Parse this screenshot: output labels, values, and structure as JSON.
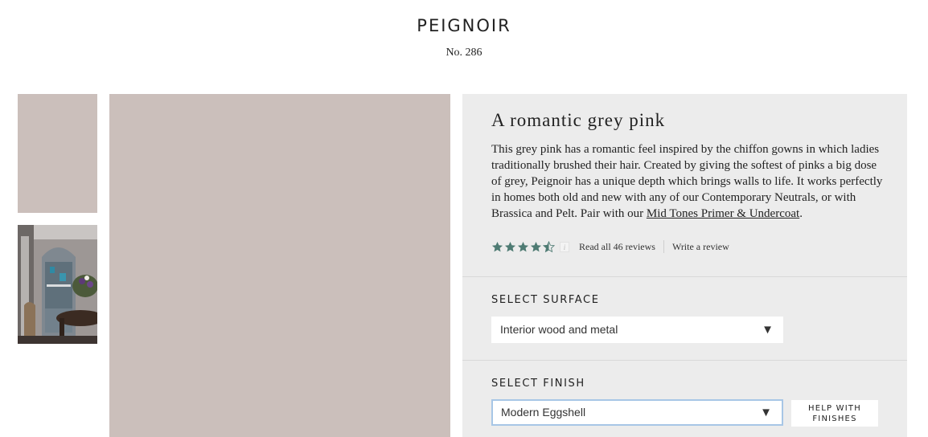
{
  "product": {
    "name": "PEIGNOIR",
    "number": "No. 286",
    "swatch_color": "#cbbfbb"
  },
  "thumbnails": [
    {
      "kind": "colour-swatch",
      "color": "#cbbfbb"
    },
    {
      "kind": "room-photo"
    }
  ],
  "panel": {
    "tagline": "A romantic grey pink",
    "description": "This grey pink has a romantic feel inspired by the chiffon gowns in which ladies traditionally brushed their hair. Created by giving the softest of pinks a big dose of grey, Peignoir has a unique depth which brings walls to life. It works perfectly in homes both old and new with any of our Contemporary Neutrals, or with Brassica and Pelt. Pair with our ",
    "primer_link": "Mid Tones Primer & Undercoat",
    "description_end": ".",
    "rating": {
      "stars": 4.5,
      "max": 5,
      "star_color": "#4e7b73",
      "info_symbol": "i",
      "read_reviews": "Read all 46 reviews",
      "write_review": "Write a review"
    },
    "surface": {
      "label": "SELECT SURFACE",
      "selected": "Interior wood and metal",
      "arrow": "▼"
    },
    "finish": {
      "label": "SELECT FINISH",
      "selected": "Modern Eggshell",
      "arrow": "▼",
      "help_button": "HELP WITH FINISHES"
    }
  }
}
